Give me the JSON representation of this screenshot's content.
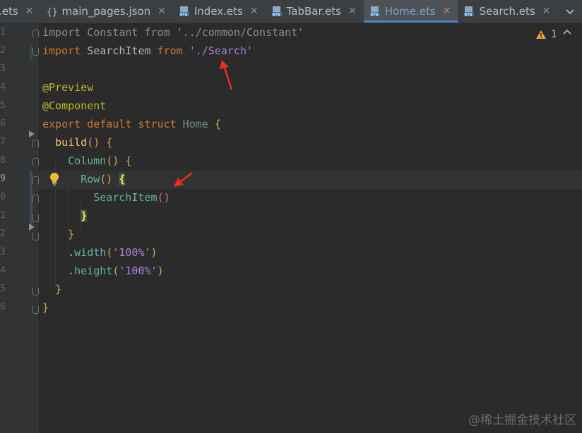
{
  "tabs": [
    {
      "label": ".ets",
      "icon": "ets-file-icon",
      "active": false,
      "close": "✕"
    },
    {
      "label": "main_pages.json",
      "icon": "json-file-icon",
      "active": false,
      "close": "✕"
    },
    {
      "label": "Index.ets",
      "icon": "ets-file-icon",
      "active": false,
      "close": "✕"
    },
    {
      "label": "TabBar.ets",
      "icon": "ets-file-icon",
      "active": false,
      "close": "✕"
    },
    {
      "label": "Home.ets",
      "icon": "ets-file-icon",
      "active": true,
      "close": "✕"
    },
    {
      "label": "Search.ets",
      "icon": "ets-file-icon",
      "active": false,
      "close": "✕"
    }
  ],
  "tab_overflow_icon": "chevron-down-icon",
  "file_icon_badge": "ETS",
  "inspection": {
    "count": "1",
    "icon": "warning-icon"
  },
  "line_numbers": [
    "1",
    "2",
    "3",
    "4",
    "5",
    "6",
    "7",
    "8",
    "9",
    "0",
    "1",
    "2",
    "3",
    "4",
    "5",
    "6"
  ],
  "current_line_index": 8,
  "code": {
    "l1": {
      "import": "import",
      "name": " Constant ",
      "from": "from",
      "path": " '../common/Constant'"
    },
    "l2": {
      "import": "import",
      "name": " SearchItem ",
      "from": "from",
      "space": " ",
      "path": "'./Search'"
    },
    "l4": {
      "ann": "@Preview"
    },
    "l5": {
      "ann": "@Component"
    },
    "l6": {
      "kw": "export default struct",
      "name": " Home",
      "brace": " {"
    },
    "l7": {
      "indent": "  ",
      "fn": "build",
      "paren": "()",
      "brace": " {"
    },
    "l8": {
      "indent": "    ",
      "comp": "Column",
      "paren": "()",
      "brace": " {"
    },
    "l9": {
      "indent": "      ",
      "comp": "Row",
      "paren": "()",
      "space": " ",
      "brace": "{"
    },
    "l10": {
      "indent": "        ",
      "comp": "SearchItem",
      "paren": "()"
    },
    "l11": {
      "indent": "      ",
      "brace": "}"
    },
    "l12": {
      "indent": "    ",
      "brace": "}"
    },
    "l13": {
      "indent": "    ",
      "dot": ".",
      "fn": "width",
      "open": "(",
      "str": "'100%'",
      "close": ")"
    },
    "l14": {
      "indent": "    ",
      "dot": ".",
      "fn": "height",
      "open": "(",
      "str": "'100%'",
      "close": ")"
    },
    "l15": {
      "indent": "  ",
      "brace": "}"
    },
    "l16": {
      "brace": "}"
    }
  },
  "colors": {
    "keyword": "#cc7832",
    "string": "#6a8759",
    "annotation": "#bbb529",
    "component": "#5fb7a4",
    "arrow": "#e8301c"
  },
  "watermark": "@稀土掘金技术社区"
}
